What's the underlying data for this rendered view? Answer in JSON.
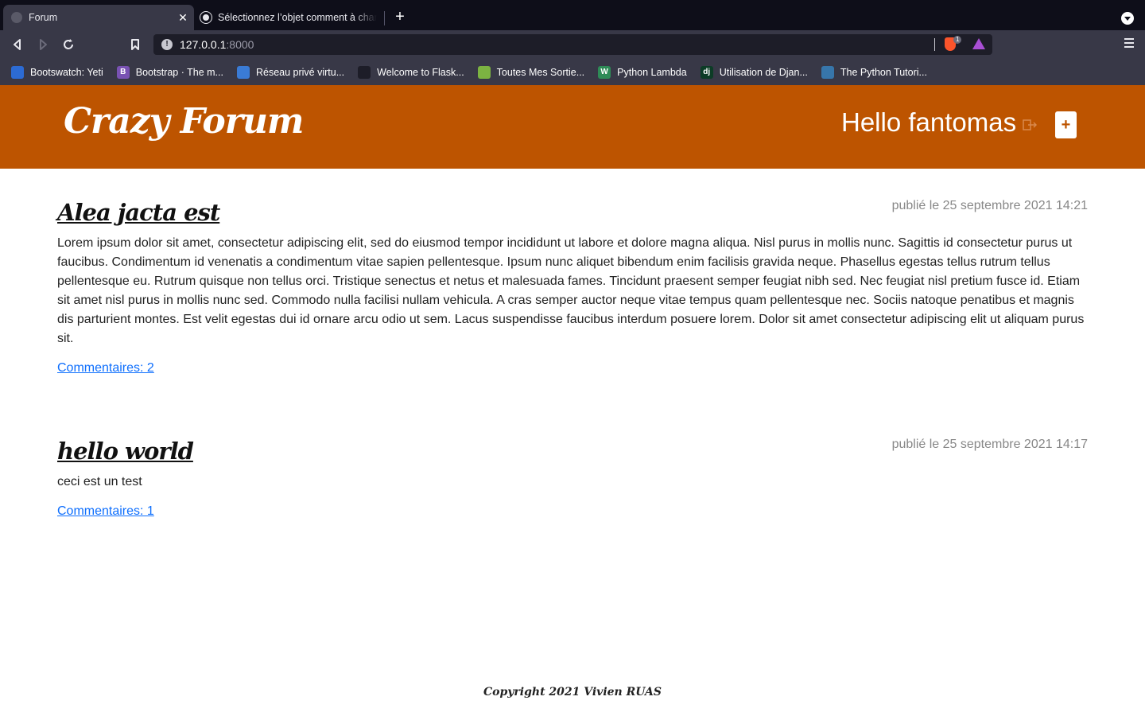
{
  "browser": {
    "tabs": [
      {
        "title": "Forum",
        "close": "✕"
      },
      {
        "title": "Sélectionnez l’objet comment à changer"
      }
    ],
    "new_tab": "+",
    "url_host": "127.0.0.1",
    "url_port": ":8000",
    "shield_count": "1",
    "bookmarks": [
      {
        "label": "Bootswatch: Yeti",
        "icon_color": "#2c6bd4",
        "icon_text": ""
      },
      {
        "label": "Bootstrap · The m...",
        "icon_color": "#7952b3",
        "icon_text": "B"
      },
      {
        "label": "Réseau privé virtu...",
        "icon_color": "#3a7bd5",
        "icon_text": ""
      },
      {
        "label": "Welcome to Flask...",
        "icon_color": "#1d1d28",
        "icon_text": ""
      },
      {
        "label": "Toutes Mes Sortie...",
        "icon_color": "#7cb342",
        "icon_text": ""
      },
      {
        "label": "Python Lambda",
        "icon_color": "#2e8b57",
        "icon_text": "W"
      },
      {
        "label": "Utilisation de Djan...",
        "icon_color": "#0c3c26",
        "icon_text": "dj"
      },
      {
        "label": "The Python Tutori...",
        "icon_color": "#3776ab",
        "icon_text": ""
      }
    ]
  },
  "header": {
    "brand": "Crazy Forum",
    "greeting": "Hello fantomas",
    "add_label": "+"
  },
  "posts": [
    {
      "title": "Alea jacta est",
      "date": "publié le 25 septembre 2021 14:21",
      "body": "Lorem ipsum dolor sit amet, consectetur adipiscing elit, sed do eiusmod tempor incididunt ut labore et dolore magna aliqua. Nisl purus in mollis nunc. Sagittis id consectetur purus ut faucibus. Condimentum id venenatis a condimentum vitae sapien pellentesque. Ipsum nunc aliquet bibendum enim facilisis gravida neque. Phasellus egestas tellus rutrum tellus pellentesque eu. Rutrum quisque non tellus orci. Tristique senectus et netus et malesuada fames. Tincidunt praesent semper feugiat nibh sed. Nec feugiat nisl pretium fusce id. Etiam sit amet nisl purus in mollis nunc sed. Commodo nulla facilisi nullam vehicula. A cras semper auctor neque vitae tempus quam pellentesque nec. Sociis natoque penatibus et magnis dis parturient montes. Est velit egestas dui id ornare arcu odio ut sem. Lacus suspendisse faucibus interdum posuere lorem. Dolor sit amet consectetur adipiscing elit ut aliquam purus sit.",
      "comments": "Commentaires: 2"
    },
    {
      "title": "hello world",
      "date": "publié le 25 septembre 2021 14:17",
      "body": "ceci est un test",
      "comments": "Commentaires: 1"
    }
  ],
  "footer": "Copyright 2021 Vivien RUAS",
  "colors": {
    "header_bg": "#bd5400",
    "link": "#0d6efd"
  }
}
